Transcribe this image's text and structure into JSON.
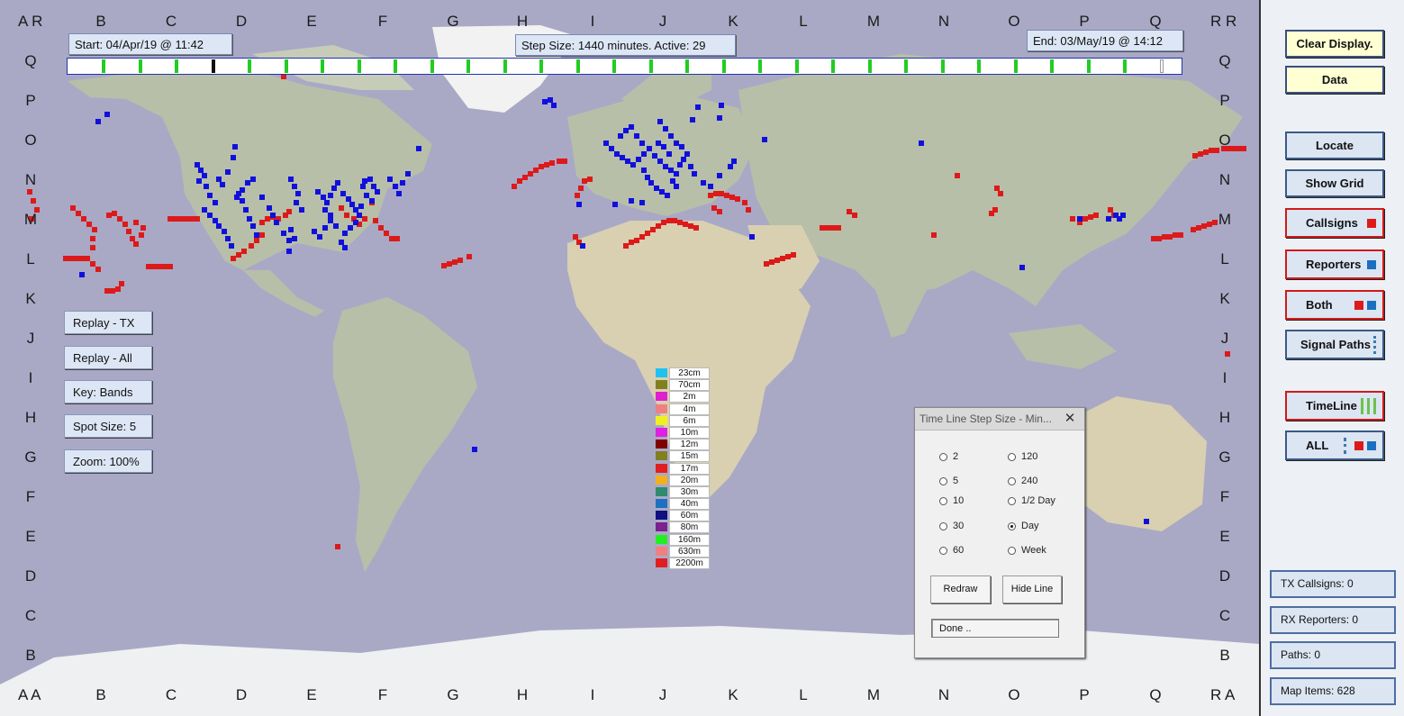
{
  "grid": {
    "columns": [
      "B",
      "C",
      "D",
      "E",
      "F",
      "G",
      "H",
      "I",
      "J",
      "K",
      "L",
      "M",
      "N",
      "O",
      "P",
      "Q"
    ],
    "rows": [
      "Q",
      "P",
      "O",
      "N",
      "M",
      "L",
      "K",
      "J",
      "I",
      "H",
      "G",
      "F",
      "E",
      "D",
      "C",
      "B"
    ],
    "corner_top_left": "A R",
    "corner_top_right": "R R",
    "corner_bottom_left": "A A",
    "corner_bottom_right": "R A"
  },
  "header": {
    "start_label": "Start: 04/Apr/19 @ 11:42",
    "step_label": "Step Size: 1440 minutes. Active: 29",
    "end_label": "End:  03/May/19 @ 14:12"
  },
  "timeline": {
    "ticks": 30,
    "active_index": 29,
    "marker_index": 3
  },
  "left_buttons": [
    {
      "label": "Replay - TX"
    },
    {
      "label": "Replay - All"
    },
    {
      "label": "Key:  Bands"
    },
    {
      "label": "Spot Size:   5"
    },
    {
      "label": "Zoom: 100%"
    }
  ],
  "legend": [
    {
      "label": "23cm",
      "color": "#1ec2f0"
    },
    {
      "label": "70cm",
      "color": "#808020"
    },
    {
      "label": "2m",
      "color": "#e020d0"
    },
    {
      "label": "4m",
      "color": "#f08080"
    },
    {
      "label": "6m",
      "color": "#f0f020"
    },
    {
      "label": "10m",
      "color": "#e020e0"
    },
    {
      "label": "12m",
      "color": "#800000"
    },
    {
      "label": "15m",
      "color": "#808020"
    },
    {
      "label": "17m",
      "color": "#e02020"
    },
    {
      "label": "20m",
      "color": "#f0b020"
    },
    {
      "label": "30m",
      "color": "#2e8b70"
    },
    {
      "label": "40m",
      "color": "#1e70c0"
    },
    {
      "label": "60m",
      "color": "#101080"
    },
    {
      "label": "80m",
      "color": "#7a2090"
    },
    {
      "label": "160m",
      "color": "#20f020"
    },
    {
      "label": "630m",
      "color": "#f08080"
    },
    {
      "label": "2200m",
      "color": "#e02020"
    }
  ],
  "dialog": {
    "title": "Time Line Step Size - Min...",
    "close": "✕",
    "options": [
      "2",
      "120",
      "5",
      "240",
      "10",
      "1/2 Day",
      "30",
      "Day",
      "60",
      "Week"
    ],
    "selected": "Day",
    "redraw_label": "Redraw",
    "hide_label": "Hide Line",
    "status": "Done .."
  },
  "panel": {
    "clear_label": "Clear Display.",
    "data_label": "Data",
    "locate_label": "Locate",
    "grid_label": "Show Grid",
    "callsigns_label": "Callsigns",
    "reporters_label": "Reporters",
    "both_label": "Both",
    "signal_label": "Signal Paths",
    "timeline_label": "TimeLine",
    "all_label": "ALL",
    "stat_tx": "TX Callsigns: 0",
    "stat_rx": "RX Reporters: 0",
    "stat_paths": "Paths:         0",
    "stat_items": "Map Items: 628"
  },
  "colors": {
    "ocean": "#a9a9c6",
    "land": "#b8bfa8",
    "callsign_spot": "#dd1a1a",
    "reporter_spot": "#1010dd",
    "timeline_tick": "#22cc22"
  }
}
